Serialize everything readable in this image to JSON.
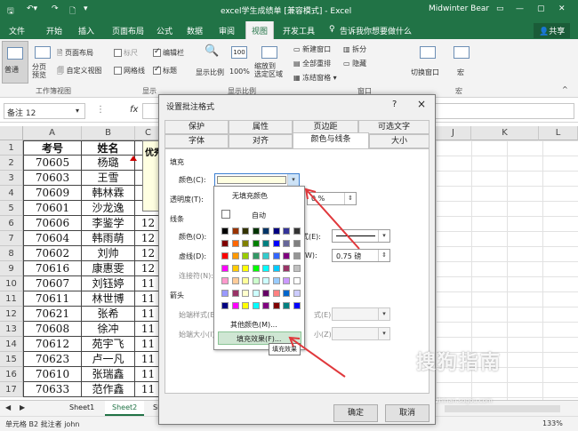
{
  "window": {
    "title": "excel学生成绩单 [兼容模式] - Excel",
    "user": "Midwinter Bear"
  },
  "tabs": [
    "文件",
    "开始",
    "插入",
    "页面布局",
    "公式",
    "数据",
    "审阅",
    "视图",
    "开发工具"
  ],
  "active_tab": "视图",
  "tell_me": "告诉我你想要做什么",
  "share": "共享",
  "ribbon": {
    "normal": "普通",
    "page_break": "分页\n预览",
    "page_layout": "页面布局",
    "custom_view": "自定义视图",
    "ruler": "标尺",
    "formula_bar": "编辑栏",
    "gridlines": "网格线",
    "headings": "标题",
    "zoom": "显示比例",
    "zoom100": "100%",
    "zoom_sel": "缩放到\n选定区域",
    "new_window": "新建窗口",
    "arrange_all": "全部重排",
    "freeze": "冻结窗格",
    "split": "拆分",
    "hide": "隐藏",
    "switch_window": "切换窗口",
    "macro": "宏",
    "groups": [
      "工作簿视图",
      "显示",
      "显示比例",
      "窗口",
      "宏"
    ]
  },
  "namebox": "备注 12",
  "fx": "fx",
  "columns": [
    "A",
    "B",
    "C",
    "D",
    "E",
    "F",
    "G",
    "H",
    "I",
    "J",
    "K",
    "L"
  ],
  "rows": [
    [
      "考号",
      "姓名",
      "语"
    ],
    [
      "70605",
      "杨璐",
      "12"
    ],
    [
      "70603",
      "王雪",
      "12"
    ],
    [
      "70609",
      "韩林霖",
      "12"
    ],
    [
      "70601",
      "沙龙逸",
      "12"
    ],
    [
      "70606",
      "李鉴学",
      "12"
    ],
    [
      "70604",
      "韩雨萌",
      "12"
    ],
    [
      "70602",
      "刘帅",
      "12"
    ],
    [
      "70616",
      "康惠雯",
      "12"
    ],
    [
      "70607",
      "刘钰婷",
      "11"
    ],
    [
      "70611",
      "林世博",
      "11"
    ],
    [
      "70621",
      "张希",
      "11"
    ],
    [
      "70608",
      "徐冲",
      "11"
    ],
    [
      "70612",
      "苑宇飞",
      "11"
    ],
    [
      "70623",
      "卢一凡",
      "11"
    ],
    [
      "70610",
      "张瑞鑫",
      "11"
    ],
    [
      "70633",
      "范作鑫",
      "11"
    ]
  ],
  "comment_text": "优秀",
  "sheets": [
    "Sheet1",
    "Sheet2",
    "Sh"
  ],
  "active_sheet": "Sheet2",
  "status": {
    "text": "单元格 B2 批注者 john",
    "zoom": "133%"
  },
  "dialog": {
    "title": "设置批注格式",
    "help": "?",
    "close": "×",
    "tabs_row1": [
      "保护",
      "属性",
      "页边距",
      "可选文字"
    ],
    "tabs_row2": [
      "字体",
      "对齐",
      "颜色与线条",
      "大小"
    ],
    "active_tab": "颜色与线条",
    "fill_section": "填充",
    "color_label": "颜色(C):",
    "transparency_label": "透明度(T):",
    "transparency_value": "0 %",
    "line_section": "线条",
    "line_color_label": "颜色(O):",
    "dash_label": "虚线(D):",
    "connector_label": "连接符(N):",
    "weight_label": "W):",
    "weight_value": "0.75 磅",
    "style_label": "式(E):",
    "arrow_section": "箭头",
    "begin_style_label": "始端样式(B)",
    "begin_size_label": "始端大小(I):",
    "end_size_label": "小(Z):",
    "ok": "确定",
    "cancel": "取消"
  },
  "color_popup": {
    "no_fill": "无填充颜色",
    "auto": "自动",
    "more_colors": "其他颜色(M)...",
    "fill_effects": "填充效果(F)...",
    "tooltip": "填充效果",
    "current_color": "#ffffe1",
    "palette": [
      [
        "#000000",
        "#993300",
        "#333300",
        "#003300",
        "#003366",
        "#000080",
        "#333399",
        "#333333"
      ],
      [
        "#800000",
        "#ff6600",
        "#808000",
        "#008000",
        "#008080",
        "#0000ff",
        "#666699",
        "#808080"
      ],
      [
        "#ff0000",
        "#ff9900",
        "#99cc00",
        "#339966",
        "#33cccc",
        "#3366ff",
        "#800080",
        "#969696"
      ],
      [
        "#ff00ff",
        "#ffcc00",
        "#ffff00",
        "#00ff00",
        "#00ffff",
        "#00ccff",
        "#993366",
        "#c0c0c0"
      ],
      [
        "#ff99cc",
        "#ffcc99",
        "#ffff99",
        "#ccffcc",
        "#ccffff",
        "#99ccff",
        "#cc99ff",
        "#ffffff"
      ],
      [
        "#9999ff",
        "#993366",
        "#ffffcc",
        "#ccffff",
        "#660066",
        "#ff8080",
        "#0066cc",
        "#ccccff"
      ],
      [
        "#000080",
        "#ff00ff",
        "#ffff00",
        "#00ffff",
        "#800080",
        "#800000",
        "#008080",
        "#0000ff"
      ]
    ]
  },
  "watermark": "搜狗指南",
  "watermark_url": "zhinan.sogou.com",
  "colors": {
    "excel_green": "#217346",
    "arrow_red": "#e0383c"
  }
}
